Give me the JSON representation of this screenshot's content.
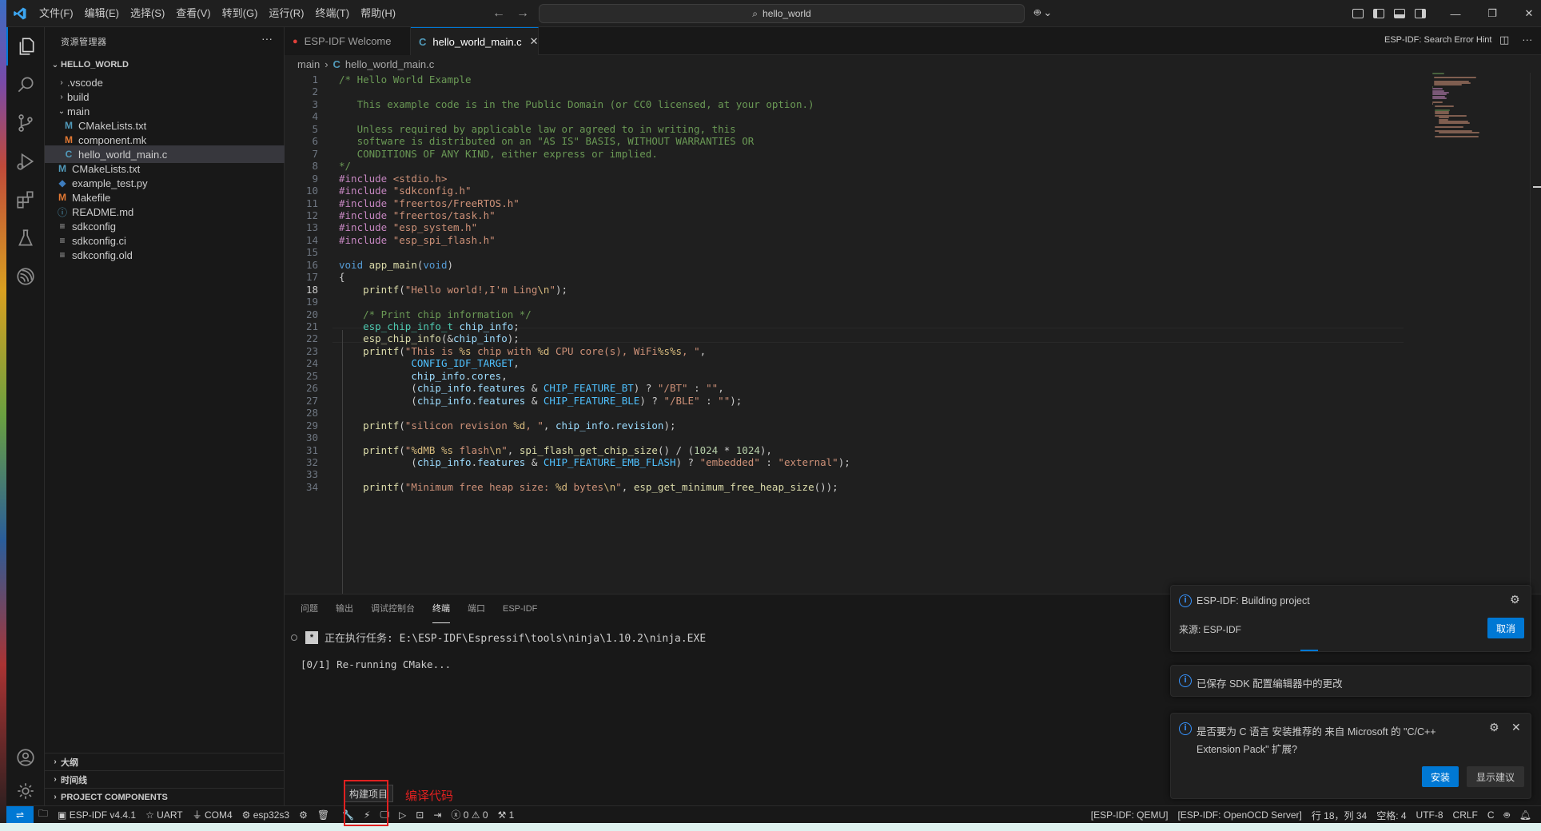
{
  "menu": [
    "文件(F)",
    "编辑(E)",
    "选择(S)",
    "查看(V)",
    "转到(G)",
    "运行(R)",
    "终端(T)",
    "帮助(H)"
  ],
  "command_center": "hello_world",
  "sidebar": {
    "title": "资源管理器",
    "root": "HELLO_WORLD",
    "items": [
      {
        "label": ".vscode",
        "type": "folder",
        "depth": 1,
        "expanded": false
      },
      {
        "label": "build",
        "type": "folder",
        "depth": 1,
        "expanded": false
      },
      {
        "label": "main",
        "type": "folder",
        "depth": 1,
        "expanded": true
      },
      {
        "label": "CMakeLists.txt",
        "type": "cmake",
        "depth": 2
      },
      {
        "label": "component.mk",
        "type": "m",
        "depth": 2
      },
      {
        "label": "hello_world_main.c",
        "type": "c",
        "depth": 2,
        "selected": true
      },
      {
        "label": "CMakeLists.txt",
        "type": "cmake",
        "depth": 1
      },
      {
        "label": "example_test.py",
        "type": "py",
        "depth": 1
      },
      {
        "label": "Makefile",
        "type": "m",
        "depth": 1
      },
      {
        "label": "README.md",
        "type": "info",
        "depth": 1
      },
      {
        "label": "sdkconfig",
        "type": "lines",
        "depth": 1
      },
      {
        "label": "sdkconfig.ci",
        "type": "lines",
        "depth": 1
      },
      {
        "label": "sdkconfig.old",
        "type": "lines",
        "depth": 1
      }
    ],
    "sections": [
      "大纲",
      "时间线",
      "PROJECT COMPONENTS"
    ]
  },
  "tabs": [
    {
      "label": "ESP-IDF Welcome",
      "active": false
    },
    {
      "label": "hello_world_main.c",
      "active": true
    }
  ],
  "tab_hint": "ESP-IDF: Search Error Hint",
  "breadcrumbs": [
    "main",
    "hello_world_main.c"
  ],
  "editor": {
    "current_line": 18,
    "lines": [
      "/* Hello World Example",
      "",
      "   This example code is in the Public Domain (or CC0 licensed, at your option.)",
      "",
      "   Unless required by applicable law or agreed to in writing, this",
      "   software is distributed on an \"AS IS\" BASIS, WITHOUT WARRANTIES OR",
      "   CONDITIONS OF ANY KIND, either express or implied.",
      "*/",
      "#include <stdio.h>",
      "#include \"sdkconfig.h\"",
      "#include \"freertos/FreeRTOS.h\"",
      "#include \"freertos/task.h\"",
      "#include \"esp_system.h\"",
      "#include \"esp_spi_flash.h\"",
      "",
      "void app_main(void)",
      "{",
      "    printf(\"Hello world!,I'm Ling\\n\");",
      "",
      "    /* Print chip information */",
      "    esp_chip_info_t chip_info;",
      "    esp_chip_info(&chip_info);",
      "    printf(\"This is %s chip with %d CPU core(s), WiFi%s%s, \",",
      "            CONFIG_IDF_TARGET,",
      "            chip_info.cores,",
      "            (chip_info.features & CHIP_FEATURE_BT) ? \"/BT\" : \"\",",
      "            (chip_info.features & CHIP_FEATURE_BLE) ? \"/BLE\" : \"\");",
      "",
      "    printf(\"silicon revision %d, \", chip_info.revision);",
      "",
      "    printf(\"%dMB %s flash\\n\", spi_flash_get_chip_size() / (1024 * 1024),",
      "            (chip_info.features & CHIP_FEATURE_EMB_FLASH) ? \"embedded\" : \"external\");",
      "",
      "    printf(\"Minimum free heap size: %d bytes\\n\", esp_get_minimum_free_heap_size());"
    ]
  },
  "panel": {
    "tabs": [
      {
        "label": "问题",
        "active": false
      },
      {
        "label": "输出",
        "active": false
      },
      {
        "label": "调试控制台",
        "active": false
      },
      {
        "label": "终端",
        "active": true
      },
      {
        "label": "端口",
        "active": false
      },
      {
        "label": "ESP-IDF",
        "active": false
      }
    ],
    "task_line": "正在执行任务: E:\\ESP-IDF\\Espressif\\tools\\ninja\\1.10.2\\ninja.EXE",
    "output_line": "[0/1] Re-running CMake..."
  },
  "notifications": [
    {
      "message": "ESP-IDF: Building project",
      "source": "来源: ESP-IDF",
      "button": "取消"
    },
    {
      "message": "已保存 SDK 配置编辑器中的更改"
    },
    {
      "message_line1": "是否要为 C 语言 安装推荐的 来自 Microsoft 的 \"C/C++",
      "message_line2": "Extension Pack\" 扩展?",
      "install": "安装",
      "show": "显示建议"
    }
  ],
  "statusbar": {
    "left": [
      "ESP-IDF v4.4.1",
      "UART",
      "COM4",
      "esp32s3"
    ],
    "errors": "0",
    "warnings": "0",
    "tools": "1",
    "right": [
      "[ESP-IDF: QEMU]",
      "[ESP-IDF: OpenOCD Server]",
      "行 18，列 34",
      "空格: 4",
      "UTF-8",
      "CRLF",
      "C"
    ]
  },
  "annotation": {
    "tooltip": "构建项目",
    "label": "编译代码"
  },
  "colors": {
    "accent": "#0078d4",
    "annotation": "#e02020"
  }
}
